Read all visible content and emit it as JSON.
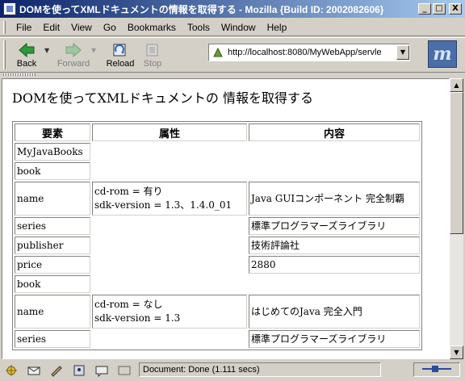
{
  "window": {
    "title": "DOMを使ってXMLドキュメントの情報を取得する - Mozilla {Build ID: 2002082606}",
    "minimize": "_",
    "maximize": "□",
    "close": "X"
  },
  "menu": {
    "items": [
      {
        "label": "File"
      },
      {
        "label": "Edit"
      },
      {
        "label": "View"
      },
      {
        "label": "Go"
      },
      {
        "label": "Bookmarks"
      },
      {
        "label": "Tools"
      },
      {
        "label": "Window"
      },
      {
        "label": "Help"
      }
    ]
  },
  "toolbar": {
    "back": "Back",
    "forward": "Forward",
    "reload": "Reload",
    "stop": "Stop",
    "url": "http://localhost:8080/MyWebApp/servle",
    "brand": "m"
  },
  "page": {
    "heading": "DOMを使ってXMLドキュメントの 情報を取得する",
    "headers": [
      "要素",
      "属性",
      "内容"
    ],
    "rows": [
      {
        "element": "MyJavaBooks",
        "attr1": "",
        "attr2": "",
        "content": ""
      },
      {
        "element": "book",
        "attr1": "",
        "attr2": "",
        "content": ""
      },
      {
        "element": "name",
        "attr1": "cd-rom = 有り",
        "attr2": "sdk-version = 1.3、1.4.0_01",
        "content": "Java GUIコンポーネント 完全制覇"
      },
      {
        "element": "series",
        "attr1": "",
        "attr2": "",
        "content": "標準プログラマーズライブラリ"
      },
      {
        "element": "publisher",
        "attr1": "",
        "attr2": "",
        "content": "技術評論社"
      },
      {
        "element": "price",
        "attr1": "",
        "attr2": "",
        "content": "2880"
      },
      {
        "element": "book",
        "attr1": "",
        "attr2": "",
        "content": ""
      },
      {
        "element": "name",
        "attr1": "cd-rom = なし",
        "attr2": "sdk-version = 1.3",
        "content": "はじめてのJava 完全入門"
      },
      {
        "element": "series",
        "attr1": "",
        "attr2": "",
        "content": "標準プログラマーズライブラリ"
      }
    ]
  },
  "status": {
    "text": "Document: Done (1.111 secs)"
  },
  "colors": {
    "titlebar_start": "#0a246a",
    "titlebar_end": "#a6caf0",
    "chrome": "#d4d0c8"
  }
}
